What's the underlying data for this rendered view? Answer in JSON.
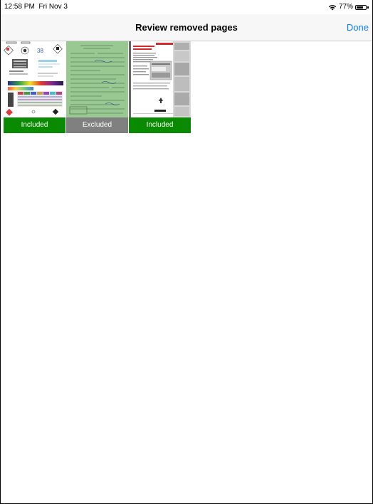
{
  "status": {
    "time": "12:58 PM",
    "date": "Fri Nov 3",
    "battery": "77%",
    "battery_level": 0.77
  },
  "nav": {
    "title": "Review removed pages",
    "done": "Done"
  },
  "colors": {
    "accent": "#0a7cff",
    "included": "#0a8a00",
    "excluded": "#808080"
  },
  "pages": [
    {
      "status": "Included"
    },
    {
      "status": "Excluded"
    },
    {
      "status": "Included"
    }
  ],
  "thumb1": {
    "number": "38"
  }
}
